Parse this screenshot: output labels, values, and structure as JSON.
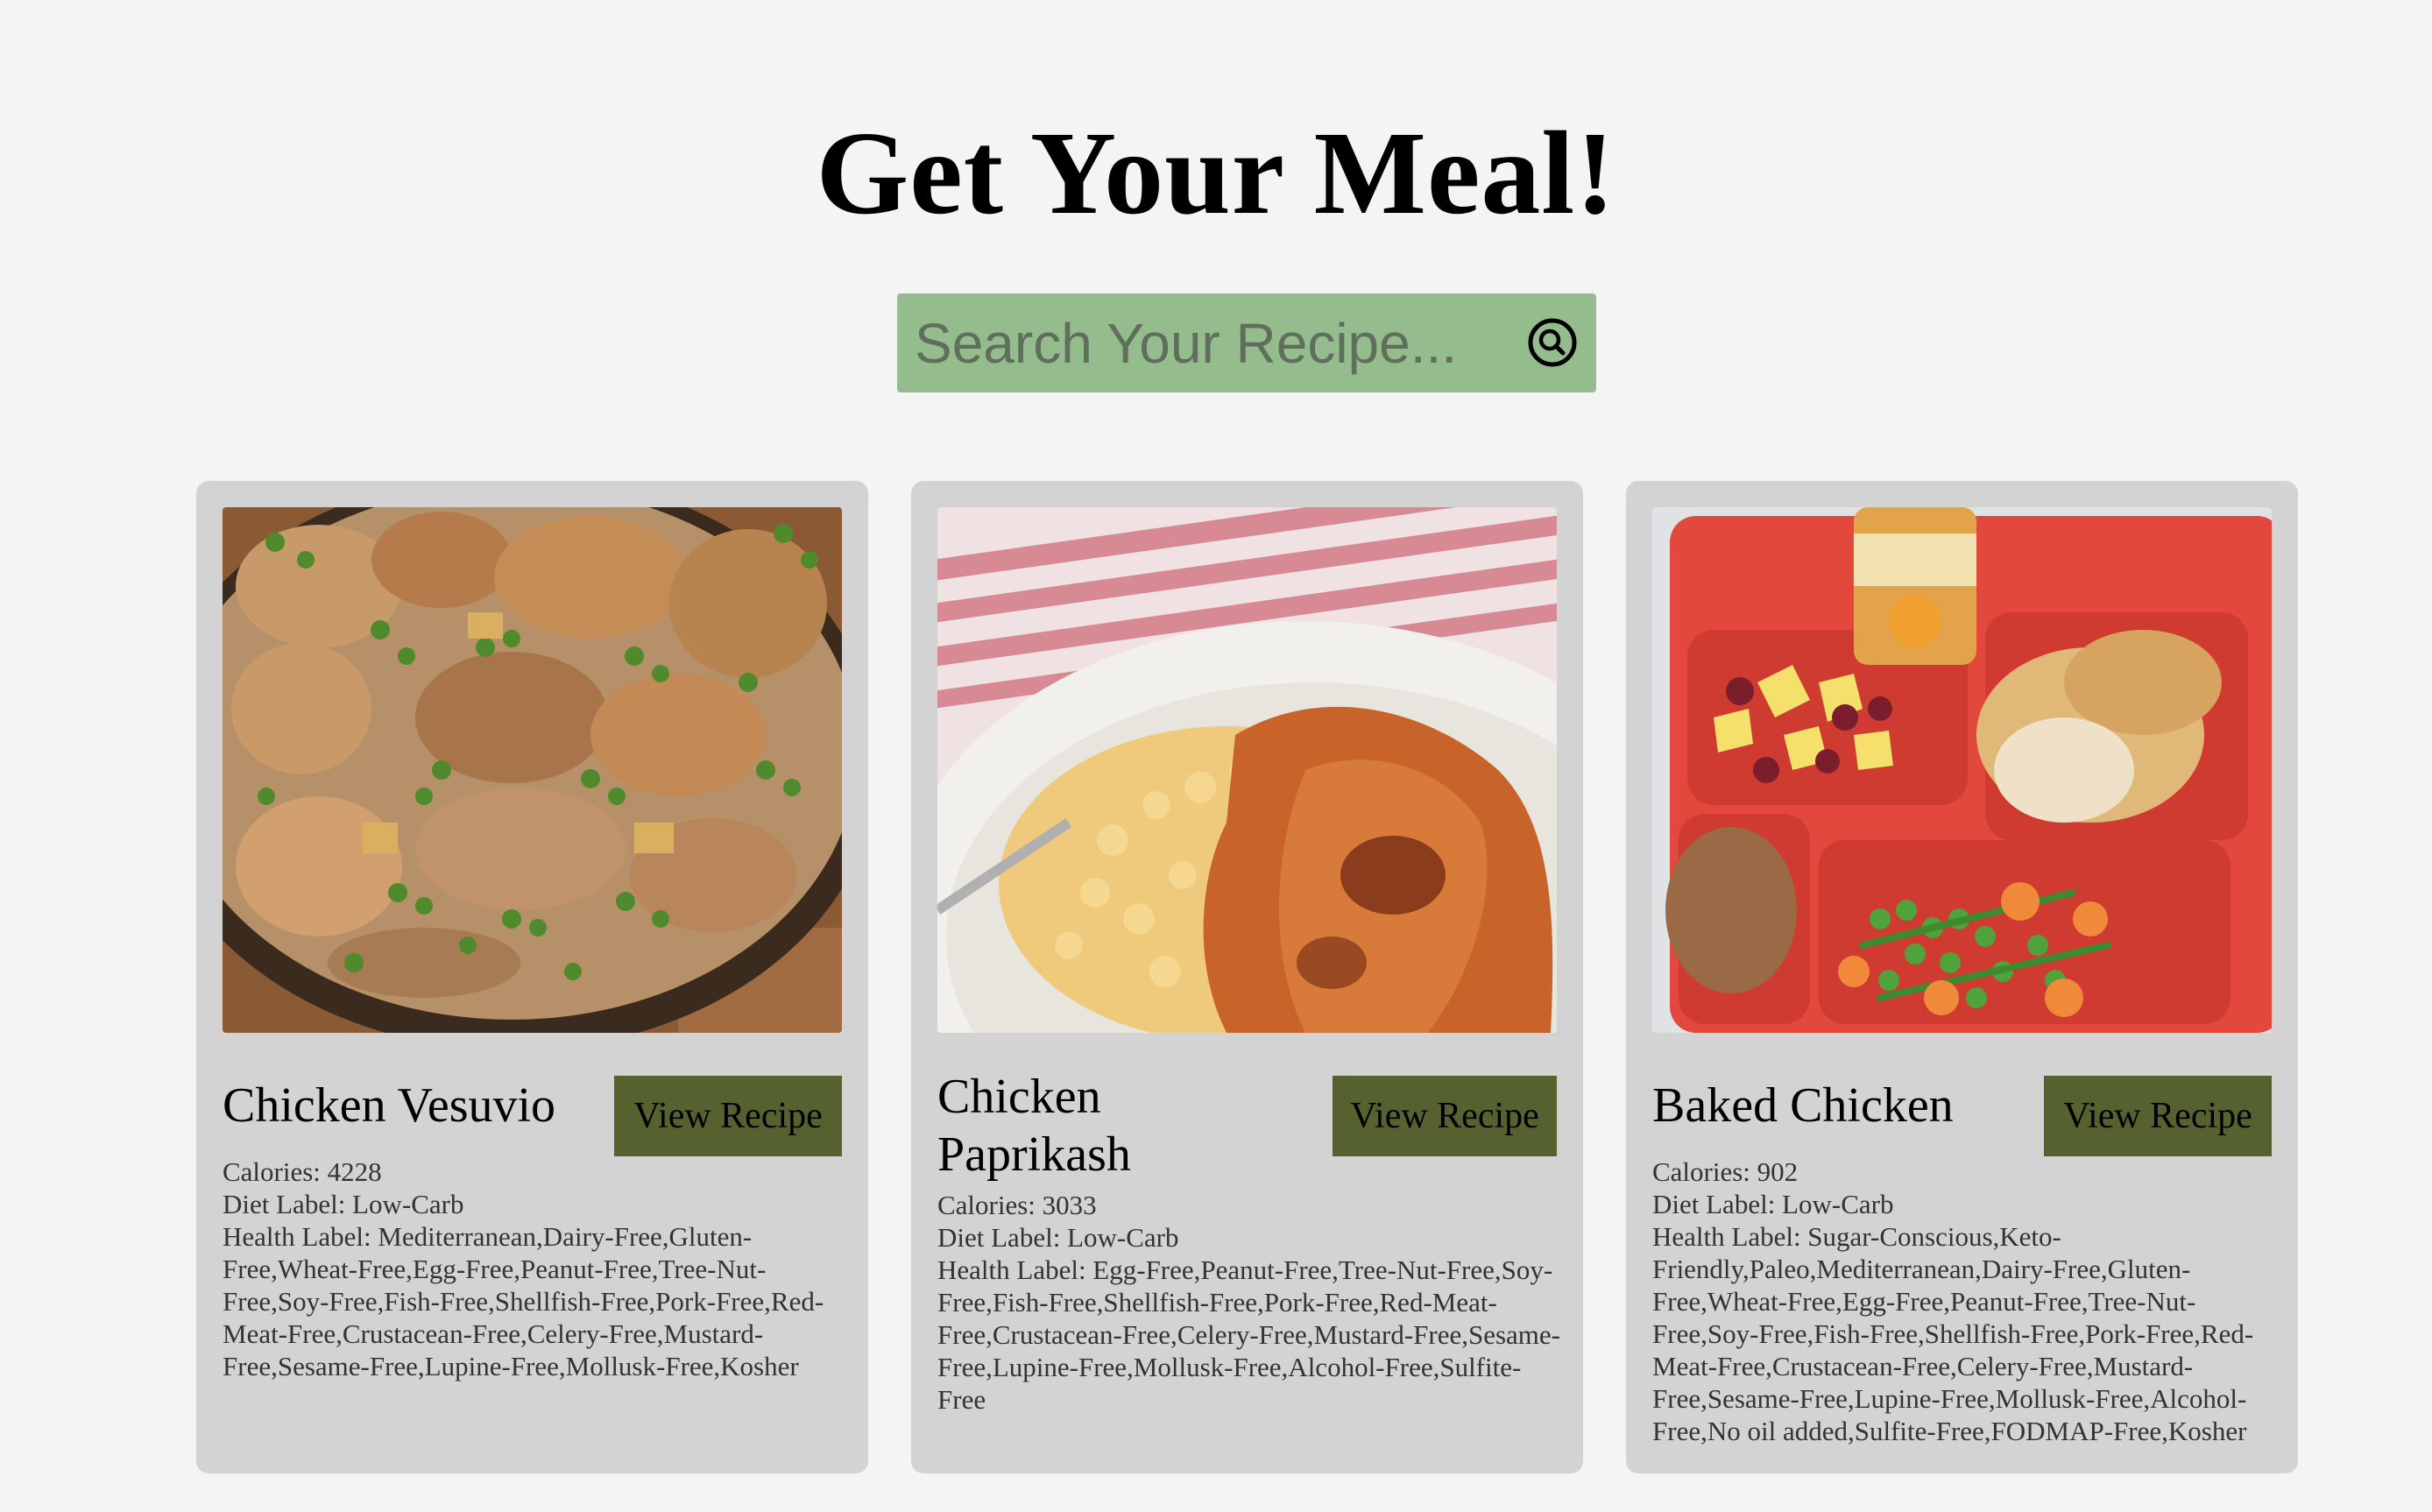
{
  "header": {
    "title": "Get Your Meal!"
  },
  "search": {
    "placeholder": "Search Your Recipe...",
    "value": "",
    "icon": "search-icon"
  },
  "recipes": [
    {
      "title": "Chicken Vesuvio",
      "button_label": "View Recipe",
      "calories": "Calories: 4228",
      "diet_label": "Diet Label: Low-Carb",
      "health_label": "Health Label: Mediterranean,Dairy-Free,Gluten-Free,Wheat-Free,Egg-Free,Peanut-Free,Tree-Nut-Free,Soy-Free,Fish-Free,Shellfish-Free,Pork-Free,Red-Meat-Free,Crustacean-Free,Celery-Free,Mustard-Free,Sesame-Free,Lupine-Free,Mollusk-Free,Kosher",
      "image": "chicken-peas-skillet-photo"
    },
    {
      "title": "Chicken Paprikash",
      "button_label": "View Recipe",
      "calories": "Calories: 3033",
      "diet_label": "Diet Label: Low-Carb",
      "health_label": "Health Label: Egg-Free,Peanut-Free,Tree-Nut-Free,Soy-Free,Fish-Free,Shellfish-Free,Pork-Free,Red-Meat-Free,Crustacean-Free,Celery-Free,Mustard-Free,Sesame-Free,Lupine-Free,Mollusk-Free,Alcohol-Free,Sulfite-Free",
      "image": "chicken-paprikash-noodles-photo"
    },
    {
      "title": "Baked Chicken",
      "button_label": "View Recipe",
      "calories": "Calories: 902",
      "diet_label": "Diet Label: Low-Carb",
      "health_label": "Health Label: Sugar-Conscious,Keto-Friendly,Paleo,Mediterranean,Dairy-Free,Gluten-Free,Wheat-Free,Egg-Free,Peanut-Free,Tree-Nut-Free,Soy-Free,Fish-Free,Shellfish-Free,Pork-Free,Red-Meat-Free,Crustacean-Free,Celery-Free,Mustard-Free,Sesame-Free,Lupine-Free,Mollusk-Free,Alcohol-Free,No oil added,Sulfite-Free,FODMAP-Free,Kosher",
      "image": "baked-chicken-lunch-tray-photo"
    }
  ],
  "colors": {
    "background": "#f4f4f4",
    "search_bg": "#94bc8d",
    "card_bg": "#d3d3d3",
    "button_bg": "#55622f"
  }
}
